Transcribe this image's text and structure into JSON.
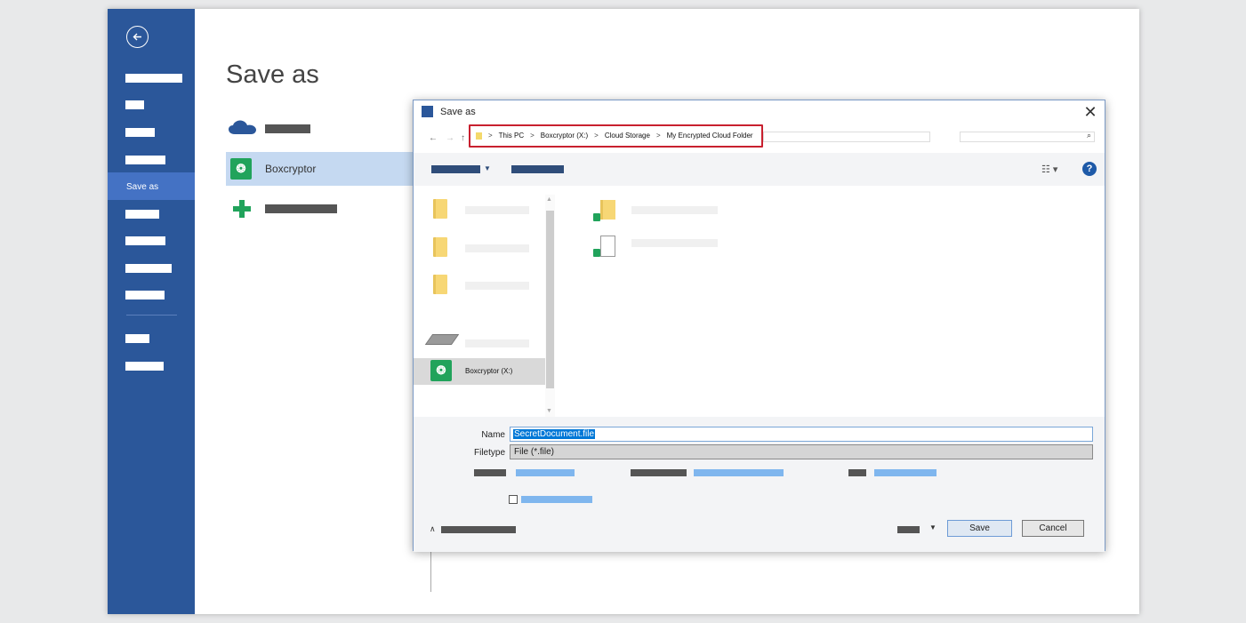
{
  "backstage": {
    "title": "Save as",
    "sidebar": {
      "active_item": "Save as"
    },
    "places": [
      {
        "id": "onedrive",
        "label": ""
      },
      {
        "id": "boxcryptor",
        "label": "Boxcryptor"
      },
      {
        "id": "add-place",
        "label": ""
      }
    ]
  },
  "dialog": {
    "title": "Save as",
    "close_glyph": "✕",
    "breadcrumb": [
      "This PC",
      "Boxcryptor (X:)",
      "Cloud Storage",
      "My Encrypted Cloud Folder"
    ],
    "breadcrumb_separator": ">",
    "nav_pane": {
      "selected_drive": "Boxcryptor (X:)"
    },
    "fields": {
      "name_label": "Name",
      "name_value": "SecretDocument.file",
      "filetype_label": "Filetype",
      "filetype_value": "File (*.file)"
    },
    "buttons": {
      "save": "Save",
      "cancel": "Cancel"
    },
    "help_glyph": "?"
  },
  "colors": {
    "office_blue": "#2b579a",
    "highlight_red": "#c8202f",
    "boxcryptor_green": "#21a35b",
    "selection_blue": "#0078d7"
  },
  "icons": [
    "back-arrow-icon",
    "onedrive-cloud-icon",
    "boxcryptor-icon",
    "add-place-icon",
    "word-icon",
    "close-icon",
    "search-icon",
    "view-icon",
    "help-icon",
    "folder-icon",
    "drive-icon",
    "document-icon",
    "lock-icon"
  ]
}
